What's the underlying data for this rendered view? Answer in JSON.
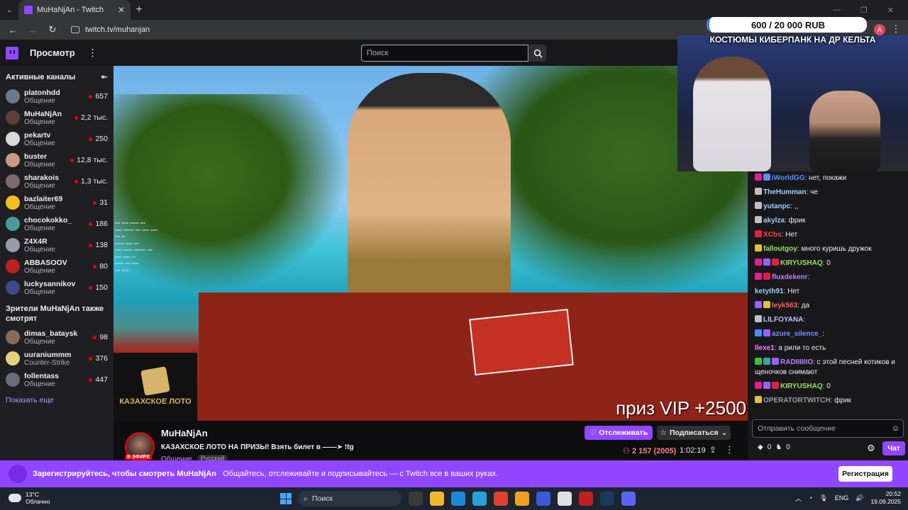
{
  "browser": {
    "tab_title": "MuHaNjAn - Twitch",
    "url": "twitch.tv/muhanjan",
    "profile_initial": "A"
  },
  "topnav": {
    "browse_label": "Просмотр",
    "search_placeholder": "Поиск"
  },
  "sidebar": {
    "active_header": "Активные каналы",
    "channels": [
      {
        "name": "platonhdd",
        "category": "Общение",
        "viewers": "657",
        "color": "#6a7a8a"
      },
      {
        "name": "MuHaNjAn",
        "category": "Общение",
        "viewers": "2,2 тыс.",
        "color": "#5a4036"
      },
      {
        "name": "pekartv",
        "category": "Общение",
        "viewers": "250",
        "color": "#d8d8d8"
      },
      {
        "name": "buster",
        "category": "Общение",
        "viewers": "12,8 тыс.",
        "color": "#c89a80"
      },
      {
        "name": "sharakois",
        "category": "Общение",
        "viewers": "1,3 тыс.",
        "color": "#7a6a6a"
      },
      {
        "name": "bazlaiter69",
        "category": "Общение",
        "viewers": "31",
        "color": "#f0c020"
      },
      {
        "name": "chocokokko_",
        "category": "Общение",
        "viewers": "186",
        "color": "#4a9a9a"
      },
      {
        "name": "Z4X4R",
        "category": "Общение",
        "viewers": "138",
        "color": "#9a9aa8"
      },
      {
        "name": "ABBASOOV",
        "category": "Общение",
        "viewers": "80",
        "color": "#c02020"
      },
      {
        "name": "luckysannikov",
        "category": "Общение",
        "viewers": "150",
        "color": "#3a4a8a"
      }
    ],
    "also_watch_header": "Зрители MuHaNjAn также смотрят",
    "also_watch": [
      {
        "name": "dimas_bataysk",
        "category": "Общение",
        "viewers": "98",
        "color": "#8a6a5a"
      },
      {
        "name": "uuraniummm",
        "category": "Counter-Strike",
        "viewers": "376",
        "color": "#e0d080"
      },
      {
        "name": "follentass",
        "category": "Общение",
        "viewers": "447",
        "color": "#6a6a7a"
      }
    ],
    "show_more": "Показать еще"
  },
  "video": {
    "prize_text": "приз VIP +2500",
    "lotto_logo_text": "КАЗАХСКОЕ ЛОТО",
    "donation_goal": "600 / 20 000 RUB",
    "donation_title": "КОСТЮМЫ КИБЕРПАНК НА ДР КЕЛЬТА"
  },
  "stream": {
    "streamer": "MuHaNjAn",
    "live_badge": "В ЭФИРЕ",
    "title": "КАЗАХСКОЕ ЛОТО НА ПРИЗЫ! Взять билет в ——➤ !tg",
    "category": "Общение",
    "language": "Русский",
    "follow_label": "Отслеживать",
    "subscribe_label": "Подписаться",
    "viewers": "2 157 (2005)",
    "uptime": "1:02:19"
  },
  "chat": {
    "messages": [
      {
        "user": "iWorldGG",
        "color": "#5a8cff",
        "text": ": нет, покажи",
        "badges": [
          "#e02090",
          "#5a8cff"
        ]
      },
      {
        "user": "TheHumman",
        "color": "#9ad0ff",
        "text": ": че",
        "badges": [
          "#c0c0c0"
        ]
      },
      {
        "user": "yutanpc",
        "color": "#9ad0ff",
        "text": ": ,,",
        "badges": [
          "#c0c0c0"
        ]
      },
      {
        "user": "akylza",
        "color": "#9ad0ff",
        "text": ": фрик",
        "badges": [
          "#c0c0c0"
        ]
      },
      {
        "user": "XCbs",
        "color": "#ff4040",
        "text": ": Нет",
        "badges": [
          "#e02040"
        ]
      },
      {
        "user": "falloutgoy",
        "color": "#9ae060",
        "text": ": много куришь дружок",
        "badges": [
          "#e0c040"
        ]
      },
      {
        "user": "KIRYUSHAQ",
        "color": "#9ae060",
        "text": ": 0",
        "badges": [
          "#e02090",
          "#9a60ff",
          "#e02040"
        ]
      },
      {
        "user": "fluxdekenr",
        "color": "#c080ff",
        "text": ":",
        "badges": [
          "#e02090",
          "#e02040"
        ]
      },
      {
        "user": "ketyth91",
        "color": "#9ad0ff",
        "text": ": Нет",
        "badges": []
      },
      {
        "user": "leyk563",
        "color": "#ff6060",
        "text": ": да",
        "badges": [
          "#9a60ff",
          "#e0c040"
        ]
      },
      {
        "user": "LILFOYANA",
        "color": "#c0c0ff",
        "text": ":",
        "badges": [
          "#c0c0c0"
        ]
      },
      {
        "user": "azure_silence_",
        "color": "#7090ff",
        "text": ":",
        "badges": [
          "#4a8cff",
          "#9a60ff"
        ]
      },
      {
        "user": "llexe1",
        "color": "#ff80ff",
        "text": ": а рили то есть",
        "badges": []
      },
      {
        "user": "RADIIIIIIO",
        "color": "#c080ff",
        "text": ": с этой песней котиков и щеночков снимают",
        "badges": [
          "#40c040",
          "#40a0a0",
          "#9a60ff"
        ]
      },
      {
        "user": "KIRYUSHAQ",
        "color": "#9ae060",
        "text": ": 0",
        "badges": [
          "#e02090",
          "#9a60ff",
          "#e02040"
        ]
      },
      {
        "user": "OPERATORTWITCH",
        "color": "#9a9aa8",
        "text": ": фрик",
        "badges": [
          "#e0c040"
        ]
      }
    ],
    "input_placeholder": "Отправить сообщение",
    "points": "0",
    "points2": "0",
    "chat_button": "Чат"
  },
  "banner": {
    "bold_text": "Зарегистрируйтесь, чтобы смотреть MuHaNjAn",
    "text": "Общайтесь, отслеживайте и подписывайтесь — с Twitch все в ваших руках.",
    "register_label": "Регистрация"
  },
  "taskbar": {
    "temperature": "13°C",
    "weather": "Облачно",
    "search": "Поиск",
    "lang": "ENG",
    "time": "20:52",
    "date": "19.09.2025"
  }
}
